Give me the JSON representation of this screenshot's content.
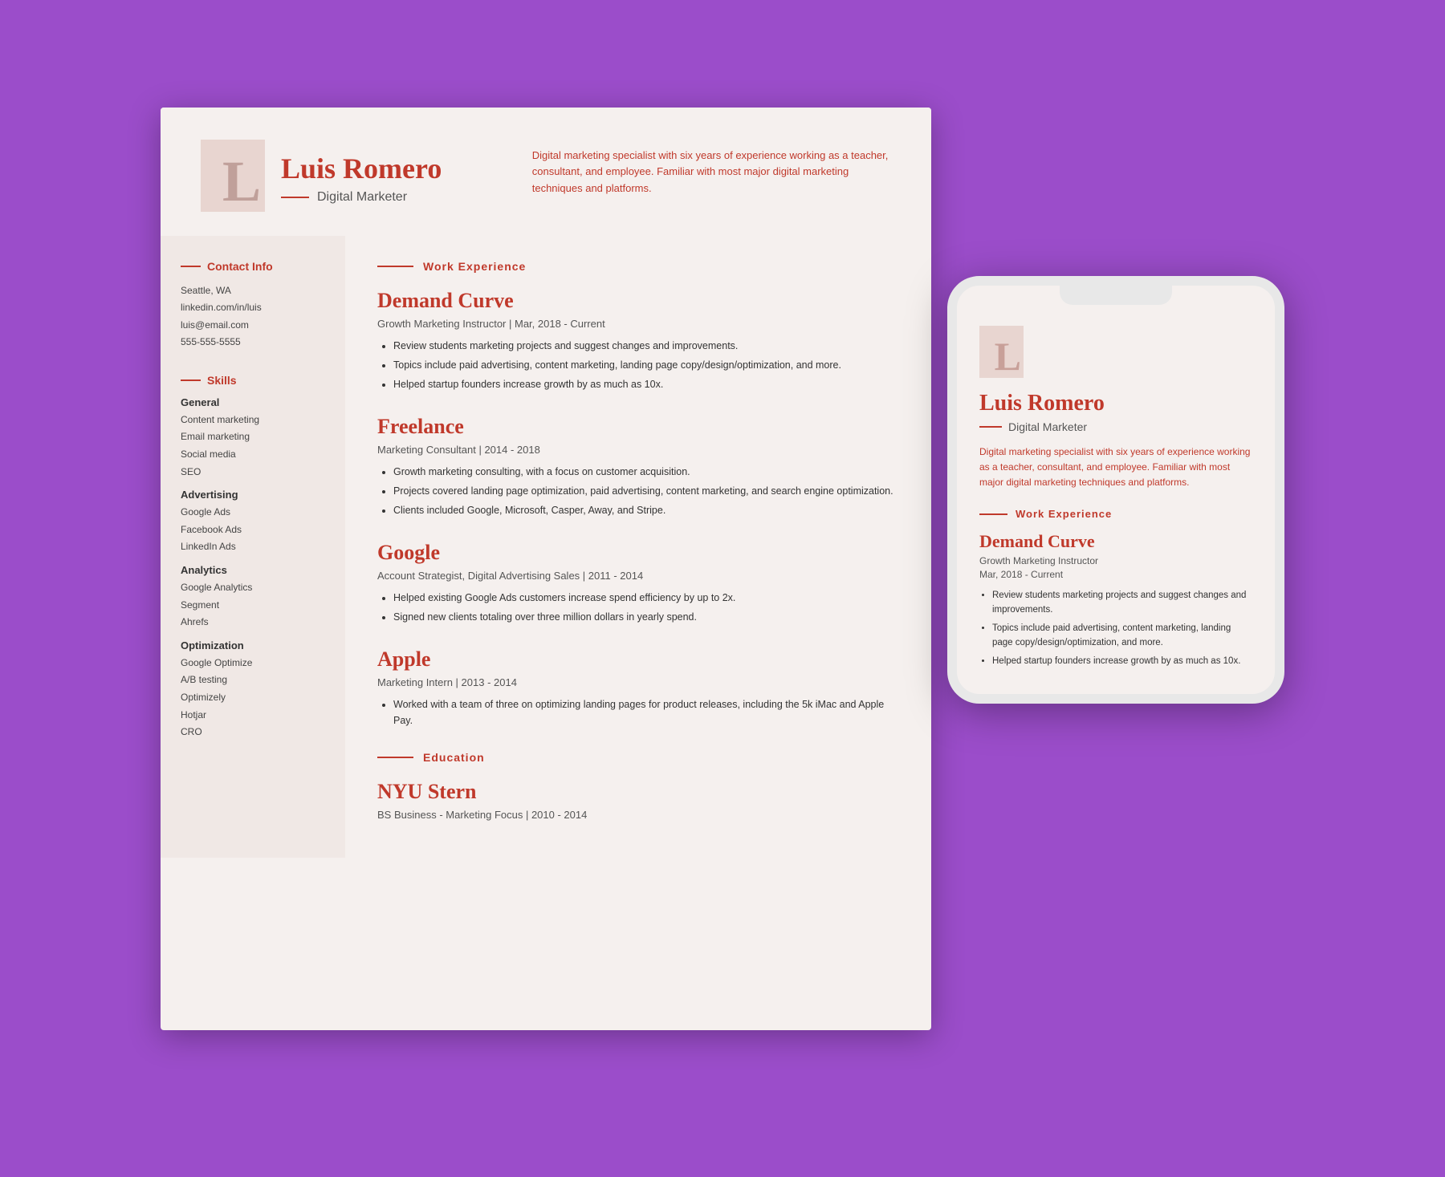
{
  "desktop": {
    "header": {
      "initial": "L",
      "name": "Luis Romero",
      "title": "Digital Marketer",
      "summary": "Digital marketing specialist with six years of experience working as a teacher, consultant, and employee. Familiar with most major digital marketing techniques and platforms."
    },
    "contact": {
      "section_title": "Contact Info",
      "items": [
        "Seattle, WA",
        "linkedin.com/in/luis",
        "luis@email.com",
        "555-555-5555"
      ]
    },
    "skills": {
      "section_title": "Skills",
      "categories": [
        {
          "title": "General",
          "items": [
            "Content marketing",
            "Email marketing",
            "Social media",
            "SEO"
          ]
        },
        {
          "title": "Advertising",
          "items": [
            "Google Ads",
            "Facebook Ads",
            "LinkedIn Ads"
          ]
        },
        {
          "title": "Analytics",
          "items": [
            "Google Analytics",
            "Segment",
            "Ahrefs"
          ]
        },
        {
          "title": "Optimization",
          "items": [
            "Google Optimize",
            "A/B testing",
            "Optimizely",
            "Hotjar",
            "CRO"
          ]
        }
      ]
    },
    "work_experience": {
      "section_title": "Work Experience",
      "jobs": [
        {
          "company": "Demand Curve",
          "role": "Growth Marketing Instructor | Mar, 2018 - Current",
          "bullets": [
            "Review students marketing projects and suggest changes and improvements.",
            "Topics include paid advertising, content marketing, landing page copy/design/optimization, and more.",
            "Helped startup founders increase growth by as much as 10x."
          ]
        },
        {
          "company": "Freelance",
          "role": "Marketing Consultant | 2014 - 2018",
          "bullets": [
            "Growth marketing consulting, with a focus on customer acquisition.",
            "Projects covered landing page optimization, paid advertising, content marketing, and search engine optimization.",
            "Clients included Google, Microsoft, Casper, Away, and Stripe."
          ]
        },
        {
          "company": "Google",
          "role": "Account Strategist, Digital Advertising Sales | 2011 - 2014",
          "bullets": [
            "Helped existing Google Ads customers increase spend efficiency by up to 2x.",
            "Signed new clients totaling over three million dollars in yearly spend."
          ]
        },
        {
          "company": "Apple",
          "role": "Marketing Intern | 2013 - 2014",
          "bullets": [
            "Worked with a team of three on optimizing landing pages for product releases, including the 5k iMac and Apple Pay."
          ]
        }
      ]
    },
    "education": {
      "section_title": "Education",
      "schools": [
        {
          "name": "NYU Stern",
          "degree": "BS Business - Marketing Focus | 2010 - 2014"
        }
      ]
    }
  },
  "mobile": {
    "initial": "L",
    "name": "Luis Romero",
    "title": "Digital Marketer",
    "summary": "Digital marketing specialist with six years of experience working as a teacher, consultant, and employee. Familiar with most major digital marketing techniques and platforms.",
    "work_experience_title": "Work Experience",
    "job": {
      "company": "Demand Curve",
      "role": "Growth Marketing Instructor",
      "dates": "Mar, 2018 - Current",
      "bullets": [
        "Review students marketing projects and suggest changes and improvements.",
        "Topics include paid advertising, content marketing, landing page copy/design/optimization, and more.",
        "Helped startup founders increase growth by as much as 10x."
      ]
    }
  }
}
